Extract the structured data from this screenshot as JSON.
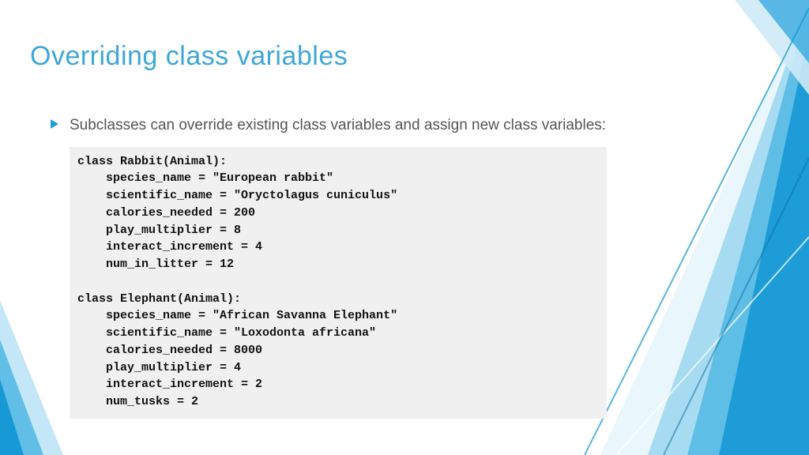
{
  "title": "Overriding class variables",
  "bullet": "Subclasses can override existing class variables and assign new class variables:",
  "code": "class Rabbit(Animal):\n    species_name = \"European rabbit\"\n    scientific_name = \"Oryctolagus cuniculus\"\n    calories_needed = 200\n    play_multiplier = 8\n    interact_increment = 4\n    num_in_litter = 12\n\nclass Elephant(Animal):\n    species_name = \"African Savanna Elephant\"\n    scientific_name = \"Loxodonta africana\"\n    calories_needed = 8000\n    play_multiplier = 4\n    interact_increment = 2\n    num_tusks = 2"
}
